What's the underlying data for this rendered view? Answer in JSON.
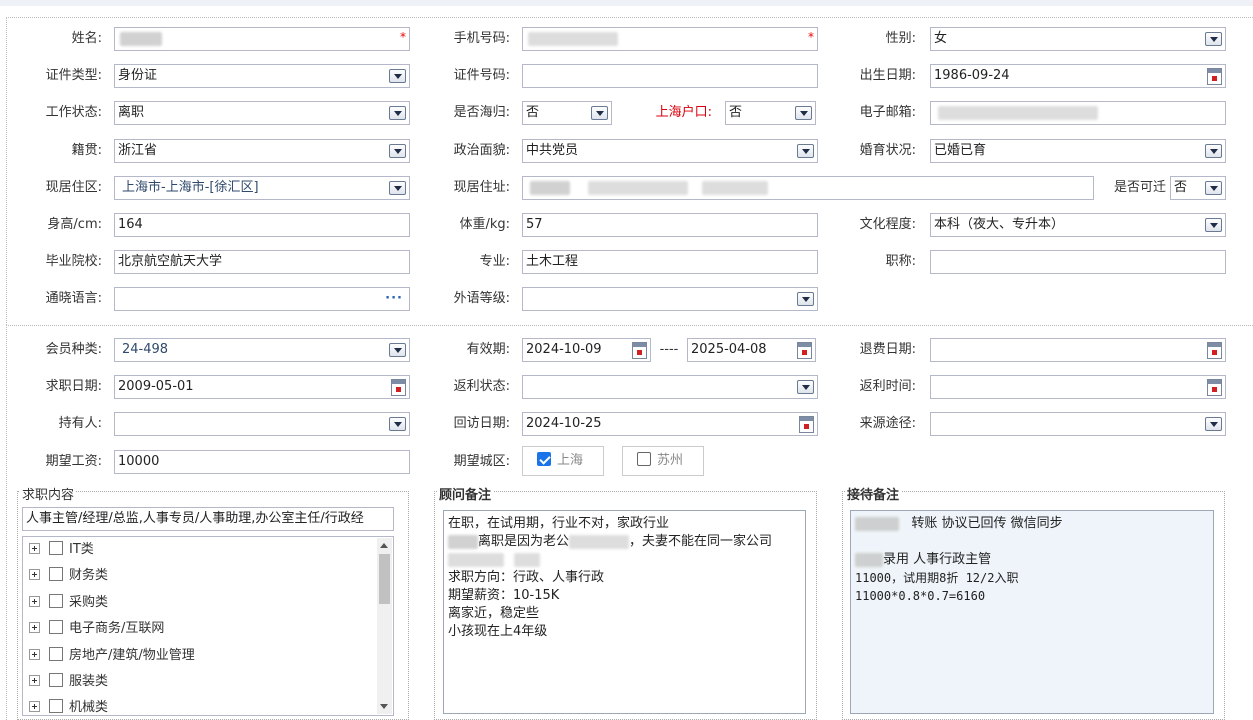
{
  "form": {
    "name": {
      "label": "姓名:",
      "value": ""
    },
    "phone": {
      "label": "手机号码:",
      "value": ""
    },
    "gender": {
      "label": "性别:",
      "value": "女"
    },
    "id_type": {
      "label": "证件类型:",
      "value": "身份证"
    },
    "id_number": {
      "label": "证件号码:",
      "value": ""
    },
    "birth_date": {
      "label": "出生日期:",
      "value": "1986-09-24"
    },
    "work_status": {
      "label": "工作状态:",
      "value": "离职"
    },
    "returnee": {
      "label": "是否海归:",
      "value": "否"
    },
    "shanghai_hukou": {
      "label": "上海户口:",
      "value": "否"
    },
    "email": {
      "label": "电子邮箱:",
      "value": ""
    },
    "native_place": {
      "label": "籍贯:",
      "value": "浙江省"
    },
    "political_status": {
      "label": "政治面貌:",
      "value": "中共党员"
    },
    "marital_status": {
      "label": "婚育状况:",
      "value": "已婚已育"
    },
    "residence_area": {
      "label": "现居住区:",
      "value": "上海市-上海市-[徐汇区]"
    },
    "residence_address": {
      "label": "现居住址:",
      "value": ""
    },
    "relocatable": {
      "label": "是否可迁",
      "value": "否"
    },
    "height": {
      "label": "身高/cm:",
      "value": "164"
    },
    "weight": {
      "label": "体重/kg:",
      "value": "57"
    },
    "education": {
      "label": "文化程度:",
      "value": "本科（夜大、专升本）"
    },
    "school": {
      "label": "毕业院校:",
      "value": "北京航空航天大学"
    },
    "major": {
      "label": "专业:",
      "value": "土木工程"
    },
    "title": {
      "label": "职称:",
      "value": ""
    },
    "languages": {
      "label": "通晓语言:",
      "value": ""
    },
    "foreign_level": {
      "label": "外语等级:",
      "value": ""
    }
  },
  "membership": {
    "member_type": {
      "label": "会员种类:",
      "value": "24-498"
    },
    "validity": {
      "label": "有效期:",
      "from": "2024-10-09",
      "separator": "----",
      "to": "2025-04-08"
    },
    "refund_date": {
      "label": "退费日期:",
      "value": ""
    },
    "job_date": {
      "label": "求职日期:",
      "value": "2009-05-01"
    },
    "rebate_status": {
      "label": "返利状态:",
      "value": ""
    },
    "rebate_time": {
      "label": "返利时间:",
      "value": ""
    },
    "holder": {
      "label": "持有人:",
      "value": ""
    },
    "visit_date": {
      "label": "回访日期:",
      "value": "2024-10-25"
    },
    "source": {
      "label": "来源途径:",
      "value": ""
    },
    "salary": {
      "label": "期望工资:",
      "value": "10000"
    },
    "city": {
      "label": "期望城区:",
      "options": [
        {
          "label": "上海",
          "checked": true
        },
        {
          "label": "苏州",
          "checked": false
        }
      ]
    }
  },
  "job_content": {
    "title": "求职内容",
    "selected": "人事主管/经理/总监,人事专员/人事助理,办公室主任/行政经",
    "items": [
      "IT类",
      "财务类",
      "采购类",
      "电子商务/互联网",
      "房地产/建筑/物业管理",
      "服装类",
      "机械类"
    ]
  },
  "advisor_notes": {
    "title": "顾问备注",
    "line1": "在职，在试用期，行业不对，家政行业",
    "line2_pre": "",
    "line2_a": "离职是因为老公",
    "line2_b": "，夫妻不能在同一家公司",
    "line4": "求职方向：行政、人事行政",
    "line5": "期望薪资：10-15K",
    "line6": "离家近，稳定些",
    "line7": "小孩现在上4年级"
  },
  "reception_notes": {
    "title": "接待备注",
    "line1": "转账   协议已回传   微信同步",
    "line2": "录用  人事行政主管",
    "line3": "11000，试用期8折    12/2入职",
    "line4": "11000*0.8*0.7=6160"
  }
}
